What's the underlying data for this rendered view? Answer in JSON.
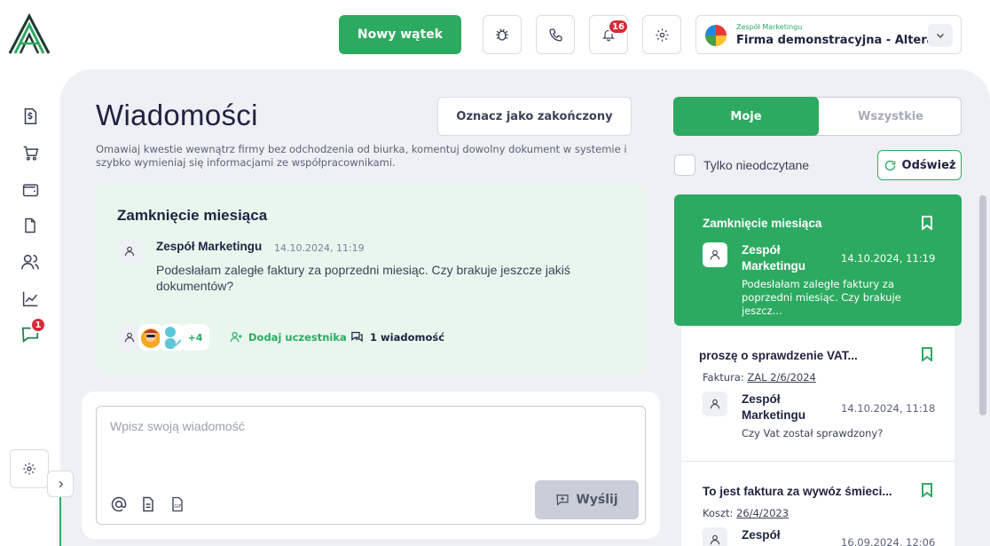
{
  "header": {
    "new_thread_label": "Nowy wątek",
    "notifications_count": "16",
    "company_subtitle": "Zespół Marketingu",
    "company_name": "Firma demonstracyjna - Altera"
  },
  "sidebar": {
    "items": [
      {
        "icon": "invoice-dollar-icon"
      },
      {
        "icon": "cart-icon"
      },
      {
        "icon": "wallet-icon"
      },
      {
        "icon": "document-icon"
      },
      {
        "icon": "users-icon"
      },
      {
        "icon": "chart-icon"
      },
      {
        "icon": "messages-icon",
        "badge": "1"
      }
    ]
  },
  "page": {
    "title": "Wiadomości",
    "mark_done_label": "Oznacz jako zakończony",
    "description": "Omawiaj kwestie wewnątrz firmy bez odchodzenia od biurka, komentuj dowolny dokument w systemie i szybko wymieniaj się informacjami ze współpracownikami."
  },
  "thread": {
    "title": "Zamknięcie miesiąca",
    "author": "Zespół Marketingu",
    "time": "14.10.2024, 11:19",
    "body": "Podesłałam zaległe faktury za poprzedni miesiąc. Czy brakuje jeszcze jakiś dokumentów?",
    "more_participants": "+4",
    "add_participant_label": "Dodaj uczestnika",
    "message_count_label": "1 wiadomość"
  },
  "composer": {
    "placeholder": "Wpisz swoją wiadomość",
    "send_label": "Wyślij"
  },
  "filters": {
    "mine_label": "Moje",
    "all_label": "Wszystkie",
    "unread_label": "Tylko nieodczytane",
    "refresh_label": "Odśwież"
  },
  "threads": [
    {
      "title": "Zamknięcie miesiąca",
      "author": "Zespół Marketingu",
      "time": "14.10.2024, 11:19",
      "preview": "Podesłałam zaległe faktury za poprzedni miesiąc. Czy brakuje jeszcz...",
      "active": true
    },
    {
      "title": " proszę o sprawdzenie VAT...",
      "doc_label": "Faktura:",
      "doc_ref": "ZAL 2/6/2024",
      "author": "Zespół Marketingu",
      "time": "14.10.2024, 11:18",
      "preview": "Czy Vat został sprawdzony?"
    },
    {
      "title": "To jest faktura za wywóz śmieci...",
      "doc_label": "Koszt:",
      "doc_ref": "26/4/2023",
      "author": "Zespół",
      "time": "16.09.2024, 12:06"
    }
  ],
  "colors": {
    "accent": "#2daa61",
    "badge": "#d62b3a",
    "panel": "#eef0f5",
    "thread_bg": "#e9f6ee"
  }
}
